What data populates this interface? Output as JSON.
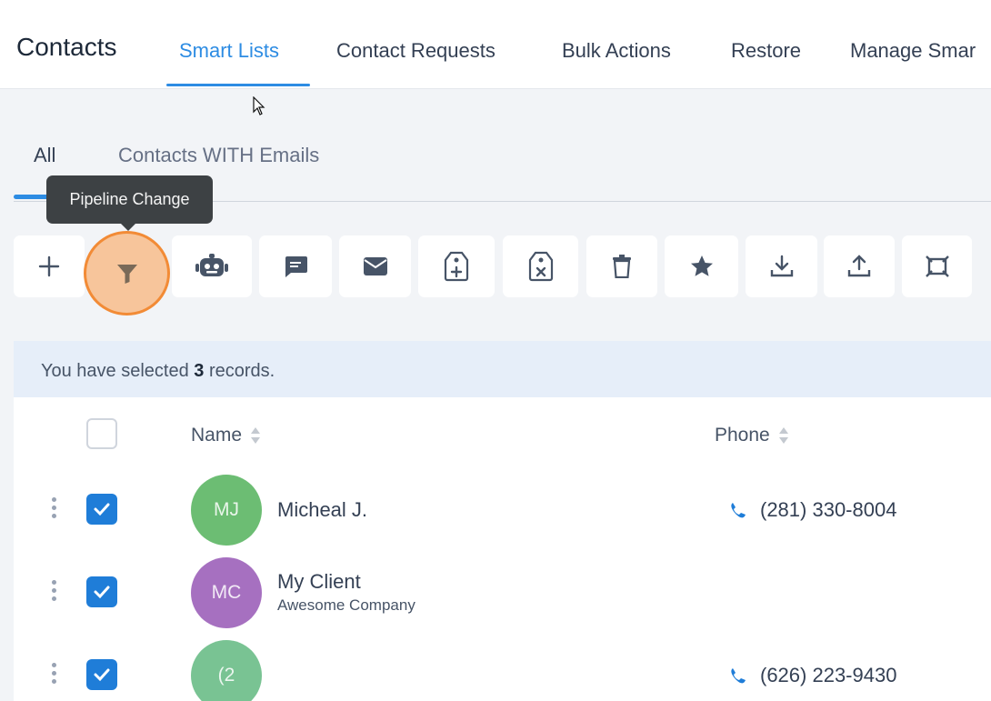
{
  "header": {
    "title": "Contacts",
    "tabs": [
      {
        "label": "Smart Lists"
      },
      {
        "label": "Contact Requests"
      },
      {
        "label": "Bulk Actions"
      },
      {
        "label": "Restore"
      },
      {
        "label": "Manage Smar"
      }
    ]
  },
  "subtabs": [
    {
      "label": "All"
    },
    {
      "label": "Contacts WITH Emails"
    }
  ],
  "tooltip": "Pipeline Change",
  "toolbar": {
    "icons": [
      "plus-icon",
      "filter-icon",
      "robot-icon",
      "message-icon",
      "email-icon",
      "tag-add-icon",
      "tag-remove-icon",
      "trash-icon",
      "star-icon",
      "download-icon",
      "upload-icon",
      "merge-icon"
    ]
  },
  "selection": {
    "prefix": "You have selected",
    "count": "3",
    "suffix": "records."
  },
  "table": {
    "columns": [
      {
        "label": "Name"
      },
      {
        "label": "Phone"
      }
    ],
    "rows": [
      {
        "initials": "MJ",
        "name": "Micheal J.",
        "company": "",
        "phone": "(281) 330-8004",
        "avatar_color": "#6cbd73",
        "checked": true
      },
      {
        "initials": "MC",
        "name": "My Client",
        "company": "Awesome Company",
        "phone": "",
        "avatar_color": "#a670c0",
        "checked": true
      },
      {
        "initials": "(2",
        "name": "",
        "company": "",
        "phone": "(626) 223-9430",
        "avatar_color": "#79c393",
        "checked": true
      }
    ]
  },
  "colors": {
    "accent": "#2d8ce3",
    "highlight": "#f28b36",
    "checkbox": "#1f7dd8"
  }
}
